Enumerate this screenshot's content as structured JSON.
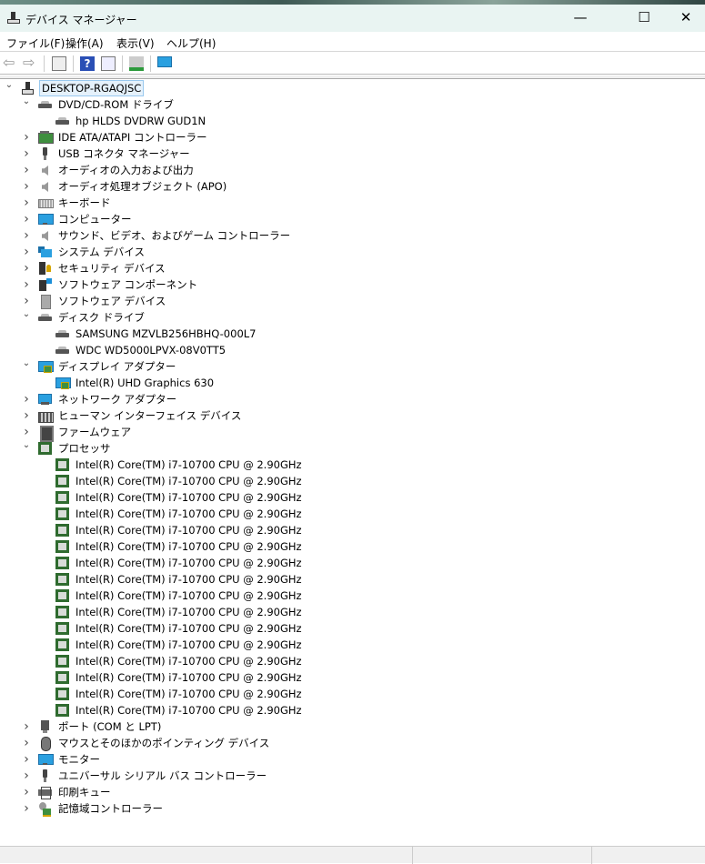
{
  "window": {
    "title": "デバイス マネージャー",
    "minimize": "—",
    "maximize": "☐",
    "close": "✕"
  },
  "menu": [
    "ファイル(F)",
    "操作(A)",
    "表示(V)",
    "ヘルプ(H)"
  ],
  "toolbar": {
    "icons": [
      "back-icon",
      "forward-icon",
      "show-hide-console-tree-icon",
      "help-icon",
      "properties-icon",
      "scan-hardware-icon",
      "monitor-icon"
    ]
  },
  "tree": [
    {
      "level": 0,
      "state": "open",
      "icon": "pc",
      "label": "DESKTOP-RGAQJSC",
      "selected": true
    },
    {
      "level": 1,
      "state": "open",
      "icon": "drive",
      "label": "DVD/CD-ROM ドライブ"
    },
    {
      "level": 2,
      "state": "leaf",
      "icon": "drive",
      "label": "hp HLDS DVDRW  GUD1N"
    },
    {
      "level": 1,
      "state": "closed",
      "icon": "chip",
      "label": "IDE ATA/ATAPI コントローラー"
    },
    {
      "level": 1,
      "state": "closed",
      "icon": "usb",
      "label": "USB コネクタ マネージャー"
    },
    {
      "level": 1,
      "state": "closed",
      "icon": "speaker",
      "label": "オーディオの入力および出力"
    },
    {
      "level": 1,
      "state": "closed",
      "icon": "speaker",
      "label": "オーディオ処理オブジェクト (APO)"
    },
    {
      "level": 1,
      "state": "closed",
      "icon": "kbd",
      "label": "キーボード"
    },
    {
      "level": 1,
      "state": "closed",
      "icon": "monitor",
      "label": "コンピューター"
    },
    {
      "level": 1,
      "state": "closed",
      "icon": "speaker",
      "label": "サウンド、ビデオ、およびゲーム コントローラー"
    },
    {
      "level": 1,
      "state": "closed",
      "icon": "sys",
      "label": "システム デバイス"
    },
    {
      "level": 1,
      "state": "closed",
      "icon": "sec",
      "label": "セキュリティ デバイス"
    },
    {
      "level": 1,
      "state": "closed",
      "icon": "comp",
      "label": "ソフトウェア コンポーネント"
    },
    {
      "level": 1,
      "state": "closed",
      "icon": "sw",
      "label": "ソフトウェア デバイス"
    },
    {
      "level": 1,
      "state": "open",
      "icon": "drive",
      "label": "ディスク ドライブ"
    },
    {
      "level": 2,
      "state": "leaf",
      "icon": "drive",
      "label": "SAMSUNG MZVLB256HBHQ-000L7"
    },
    {
      "level": 2,
      "state": "leaf",
      "icon": "drive",
      "label": "WDC WD5000LPVX-08V0TT5"
    },
    {
      "level": 1,
      "state": "open",
      "icon": "display",
      "label": "ディスプレイ アダプター"
    },
    {
      "level": 2,
      "state": "leaf",
      "icon": "display",
      "label": "Intel(R) UHD Graphics 630"
    },
    {
      "level": 1,
      "state": "closed",
      "icon": "net",
      "label": "ネットワーク アダプター"
    },
    {
      "level": 1,
      "state": "closed",
      "icon": "hid",
      "label": "ヒューマン インターフェイス デバイス"
    },
    {
      "level": 1,
      "state": "closed",
      "icon": "fw",
      "label": "ファームウェア"
    },
    {
      "level": 1,
      "state": "open",
      "icon": "cpu",
      "label": "プロセッサ"
    },
    {
      "level": 2,
      "state": "leaf",
      "icon": "cpu",
      "label": "Intel(R) Core(TM) i7-10700 CPU @ 2.90GHz"
    },
    {
      "level": 2,
      "state": "leaf",
      "icon": "cpu",
      "label": "Intel(R) Core(TM) i7-10700 CPU @ 2.90GHz"
    },
    {
      "level": 2,
      "state": "leaf",
      "icon": "cpu",
      "label": "Intel(R) Core(TM) i7-10700 CPU @ 2.90GHz"
    },
    {
      "level": 2,
      "state": "leaf",
      "icon": "cpu",
      "label": "Intel(R) Core(TM) i7-10700 CPU @ 2.90GHz"
    },
    {
      "level": 2,
      "state": "leaf",
      "icon": "cpu",
      "label": "Intel(R) Core(TM) i7-10700 CPU @ 2.90GHz"
    },
    {
      "level": 2,
      "state": "leaf",
      "icon": "cpu",
      "label": "Intel(R) Core(TM) i7-10700 CPU @ 2.90GHz"
    },
    {
      "level": 2,
      "state": "leaf",
      "icon": "cpu",
      "label": "Intel(R) Core(TM) i7-10700 CPU @ 2.90GHz"
    },
    {
      "level": 2,
      "state": "leaf",
      "icon": "cpu",
      "label": "Intel(R) Core(TM) i7-10700 CPU @ 2.90GHz"
    },
    {
      "level": 2,
      "state": "leaf",
      "icon": "cpu",
      "label": "Intel(R) Core(TM) i7-10700 CPU @ 2.90GHz"
    },
    {
      "level": 2,
      "state": "leaf",
      "icon": "cpu",
      "label": "Intel(R) Core(TM) i7-10700 CPU @ 2.90GHz"
    },
    {
      "level": 2,
      "state": "leaf",
      "icon": "cpu",
      "label": "Intel(R) Core(TM) i7-10700 CPU @ 2.90GHz"
    },
    {
      "level": 2,
      "state": "leaf",
      "icon": "cpu",
      "label": "Intel(R) Core(TM) i7-10700 CPU @ 2.90GHz"
    },
    {
      "level": 2,
      "state": "leaf",
      "icon": "cpu",
      "label": "Intel(R) Core(TM) i7-10700 CPU @ 2.90GHz"
    },
    {
      "level": 2,
      "state": "leaf",
      "icon": "cpu",
      "label": "Intel(R) Core(TM) i7-10700 CPU @ 2.90GHz"
    },
    {
      "level": 2,
      "state": "leaf",
      "icon": "cpu",
      "label": "Intel(R) Core(TM) i7-10700 CPU @ 2.90GHz"
    },
    {
      "level": 2,
      "state": "leaf",
      "icon": "cpu",
      "label": "Intel(R) Core(TM) i7-10700 CPU @ 2.90GHz"
    },
    {
      "level": 1,
      "state": "closed",
      "icon": "port",
      "label": "ポート (COM と LPT)"
    },
    {
      "level": 1,
      "state": "closed",
      "icon": "mouse",
      "label": "マウスとそのほかのポインティング デバイス"
    },
    {
      "level": 1,
      "state": "closed",
      "icon": "monitor",
      "label": "モニター"
    },
    {
      "level": 1,
      "state": "closed",
      "icon": "usb",
      "label": "ユニバーサル シリアル バス コントローラー"
    },
    {
      "level": 1,
      "state": "closed",
      "icon": "print",
      "label": "印刷キュー"
    },
    {
      "level": 1,
      "state": "closed",
      "icon": "stor",
      "label": "記憶域コントローラー"
    }
  ]
}
